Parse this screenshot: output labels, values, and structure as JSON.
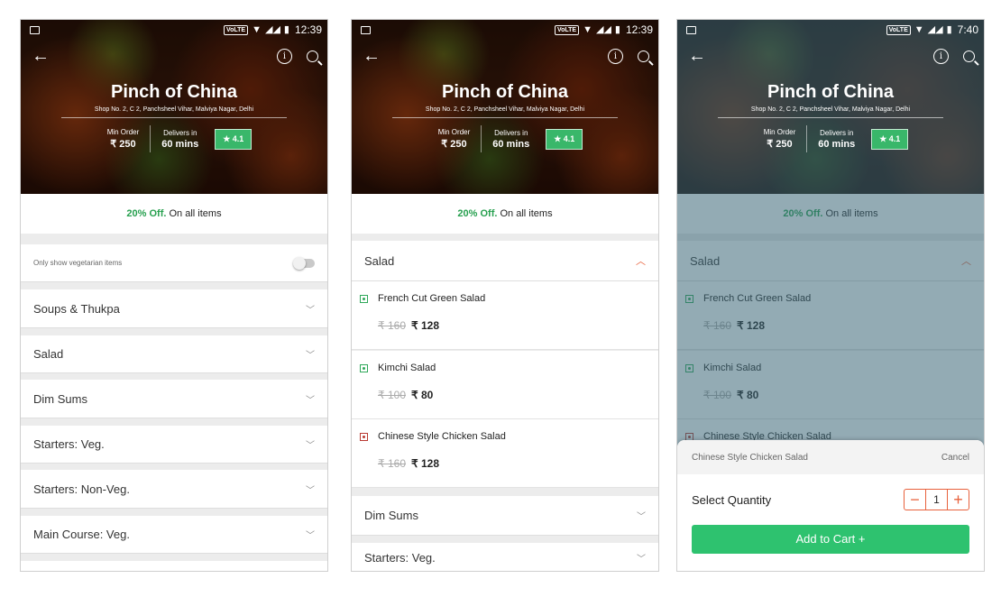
{
  "restaurant": {
    "name": "Pinch of China",
    "address": "Shop No. 2, C 2, Panchsheel Vihar, Malviya Nagar, Delhi",
    "min_order_label": "Min Order",
    "min_order_value": "₹ 250",
    "delivers_label": "Delivers in",
    "delivers_value": "60 mins",
    "rating": "★ 4.1"
  },
  "status": {
    "time_1": "12:39",
    "time_2": "12:39",
    "time_3": "7:40",
    "volte": "VoLTE"
  },
  "offer": {
    "percent": "20% Off.",
    "text": " On all items"
  },
  "screen1": {
    "veg_toggle_label": "Only show vegetarian items",
    "categories": [
      "Soups & Thukpa",
      "Salad",
      "Dim Sums",
      "Starters: Veg.",
      "Starters: Non-Veg.",
      "Main Course: Veg."
    ]
  },
  "screen2": {
    "expanded_category": "Salad",
    "items": [
      {
        "name": "French Cut Green Salad",
        "old_price": "₹ 160",
        "price": "₹ 128",
        "type": "veg"
      },
      {
        "name": "Kimchi Salad",
        "old_price": "₹ 100",
        "price": "₹ 80",
        "type": "veg"
      },
      {
        "name": "Chinese Style Chicken Salad",
        "old_price": "₹ 160",
        "price": "₹ 128",
        "type": "non-veg"
      }
    ],
    "categories_below": [
      "Dim Sums",
      "Starters: Veg."
    ]
  },
  "screen3": {
    "sheet_item": "Chinese Style Chicken Salad",
    "cancel": "Cancel",
    "select_quantity": "Select Quantity",
    "minus": "−",
    "quantity": "1",
    "plus": "+",
    "add_to_cart": "Add to Cart +"
  },
  "colors": {
    "accent_green": "#2ec26f",
    "accent_orange": "#e8613c",
    "veg_green": "#2fa85a",
    "nonveg_red": "#b93a32"
  }
}
